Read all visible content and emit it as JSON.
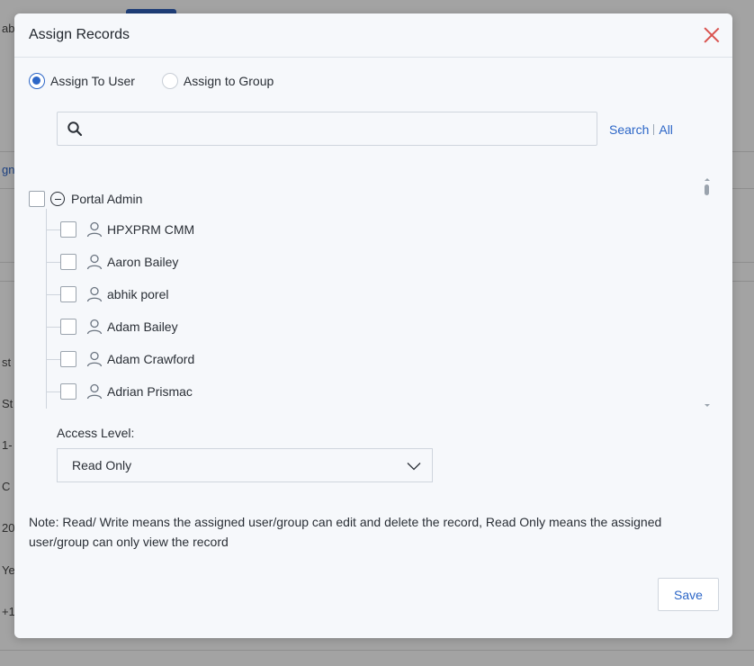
{
  "background": {
    "texts": [
      "ab",
      "gn",
      "st",
      "St",
      "1-",
      "C",
      "20",
      "Ye",
      "+1"
    ]
  },
  "modal": {
    "title": "Assign Records",
    "close_icon": "close-icon",
    "assign_options": [
      {
        "label": "Assign To User",
        "checked": true
      },
      {
        "label": "Assign to Group",
        "checked": false
      }
    ],
    "search": {
      "placeholder": "",
      "value": "",
      "search_link": "Search",
      "all_link": "All"
    },
    "tree": {
      "root_label": "Portal Admin",
      "items": [
        "HPXPRM CMM",
        "Aaron Bailey",
        "abhik porel",
        "Adam Bailey",
        "Adam Crawford",
        "Adrian Prismac"
      ]
    },
    "access_level": {
      "label": "Access Level:",
      "selected": "Read Only"
    },
    "note": "Note: Read/ Write means the assigned user/group can edit and delete the record, Read Only means the assigned user/group can only view the record",
    "save_label": "Save"
  },
  "colors": {
    "accent": "#2c66c7",
    "close": "#d9534f",
    "modal_bg": "#f6f8fb"
  }
}
